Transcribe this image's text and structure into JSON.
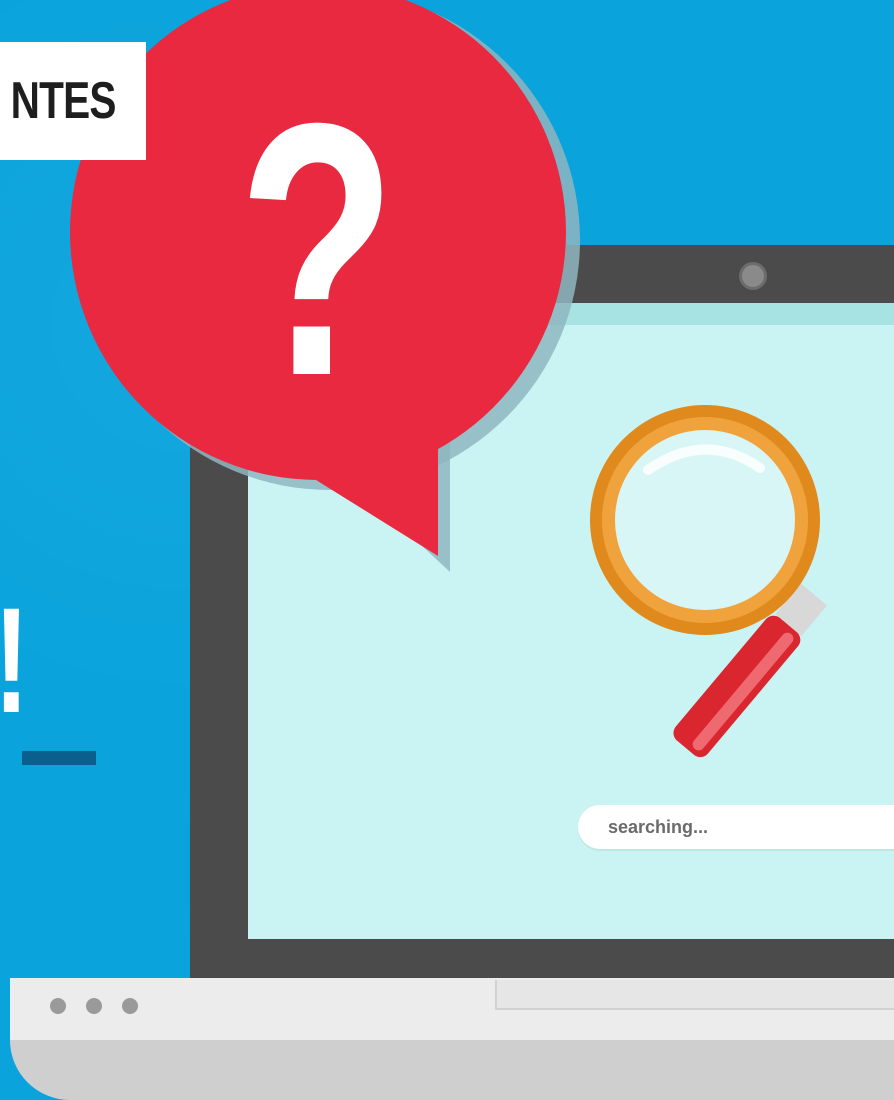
{
  "label": {
    "text": "NTES"
  },
  "headline": {
    "fragment": "!"
  },
  "speech_bubble": {
    "symbol": "?"
  },
  "search": {
    "text": "searching..."
  },
  "laptop": {
    "dots": [
      "•",
      "•",
      "•"
    ]
  },
  "colors": {
    "background": "#0aa3dc",
    "bubble": "#e8293f",
    "screen": "#c9f4f3",
    "frame": "#4b4b4b",
    "magnifier_ring": "#e08a1e",
    "magnifier_handle": "#d9262f"
  }
}
